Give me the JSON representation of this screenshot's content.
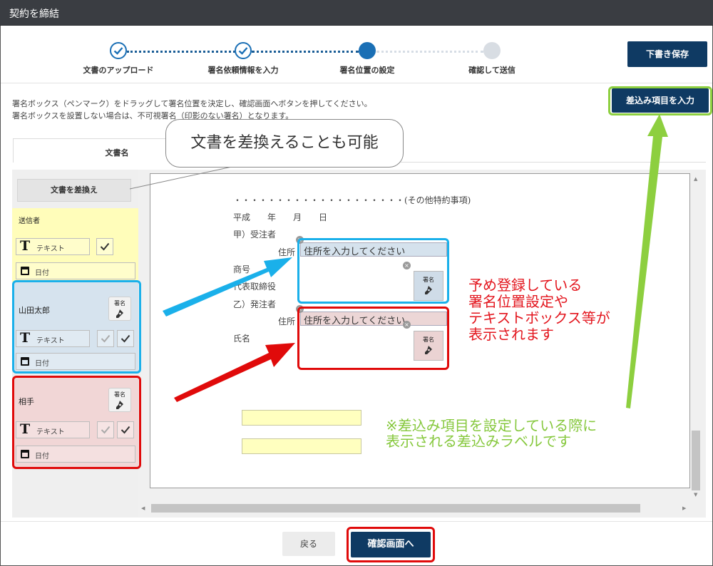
{
  "window": {
    "title": "契約を締結"
  },
  "steps": [
    {
      "label": "文書のアップロード",
      "state": "done"
    },
    {
      "label": "署名依頼情報を入力",
      "state": "done"
    },
    {
      "label": "署名位置の設定",
      "state": "current"
    },
    {
      "label": "確認して送信",
      "state": "todo"
    }
  ],
  "header": {
    "draft_save": "下書き保存",
    "merge_fields": "差込み項目を入力"
  },
  "instructions": {
    "line1": "署名ボックス（ペンマーク）をドラッグして署名位置を決定し、確認画面へボタンを押してください。",
    "line2": "署名ボックスを設置しない場合は、不可視署名（印影のない署名）となります。"
  },
  "tabs": {
    "doc_name": "文書名"
  },
  "sidebar": {
    "swap_button": "文書を差換え",
    "sender": {
      "label": "送信者",
      "text_field": "テキスト",
      "date_field": "日付"
    },
    "parties": [
      {
        "name": "山田太郎",
        "stamp": "署名",
        "text_field": "テキスト",
        "date_field": "日付"
      },
      {
        "name": "相手",
        "stamp": "署名",
        "text_field": "テキスト",
        "date_field": "日付"
      }
    ]
  },
  "document": {
    "line1": "・・・・・・・・・・・・・・・・・・・・(その他特約事項)",
    "line2": "平成　　年　　月　　日",
    "line3": "甲）受注者",
    "jusho": "住所",
    "shogo": "商号",
    "daihyo": "代表取締役",
    "line4": "乙）発注者",
    "shimei": "氏名",
    "address_placeholder": "住所を入力してください",
    "sig_label": "署名"
  },
  "annotations": {
    "callout": "文書を差換えることも可能",
    "red": [
      "予め登録している",
      "署名位置設定や",
      "テキストボックス等が",
      "表示されます"
    ],
    "green": [
      "※差込み項目を設定している際に",
      "表示される差込みラベルです"
    ]
  },
  "footer": {
    "back": "戻る",
    "confirm": "確認画面へ"
  },
  "colors": {
    "primary": "#0f3a63",
    "accent_blue": "#1ab0ea",
    "accent_red": "#e00a0a",
    "accent_green": "#8dcf3f"
  }
}
